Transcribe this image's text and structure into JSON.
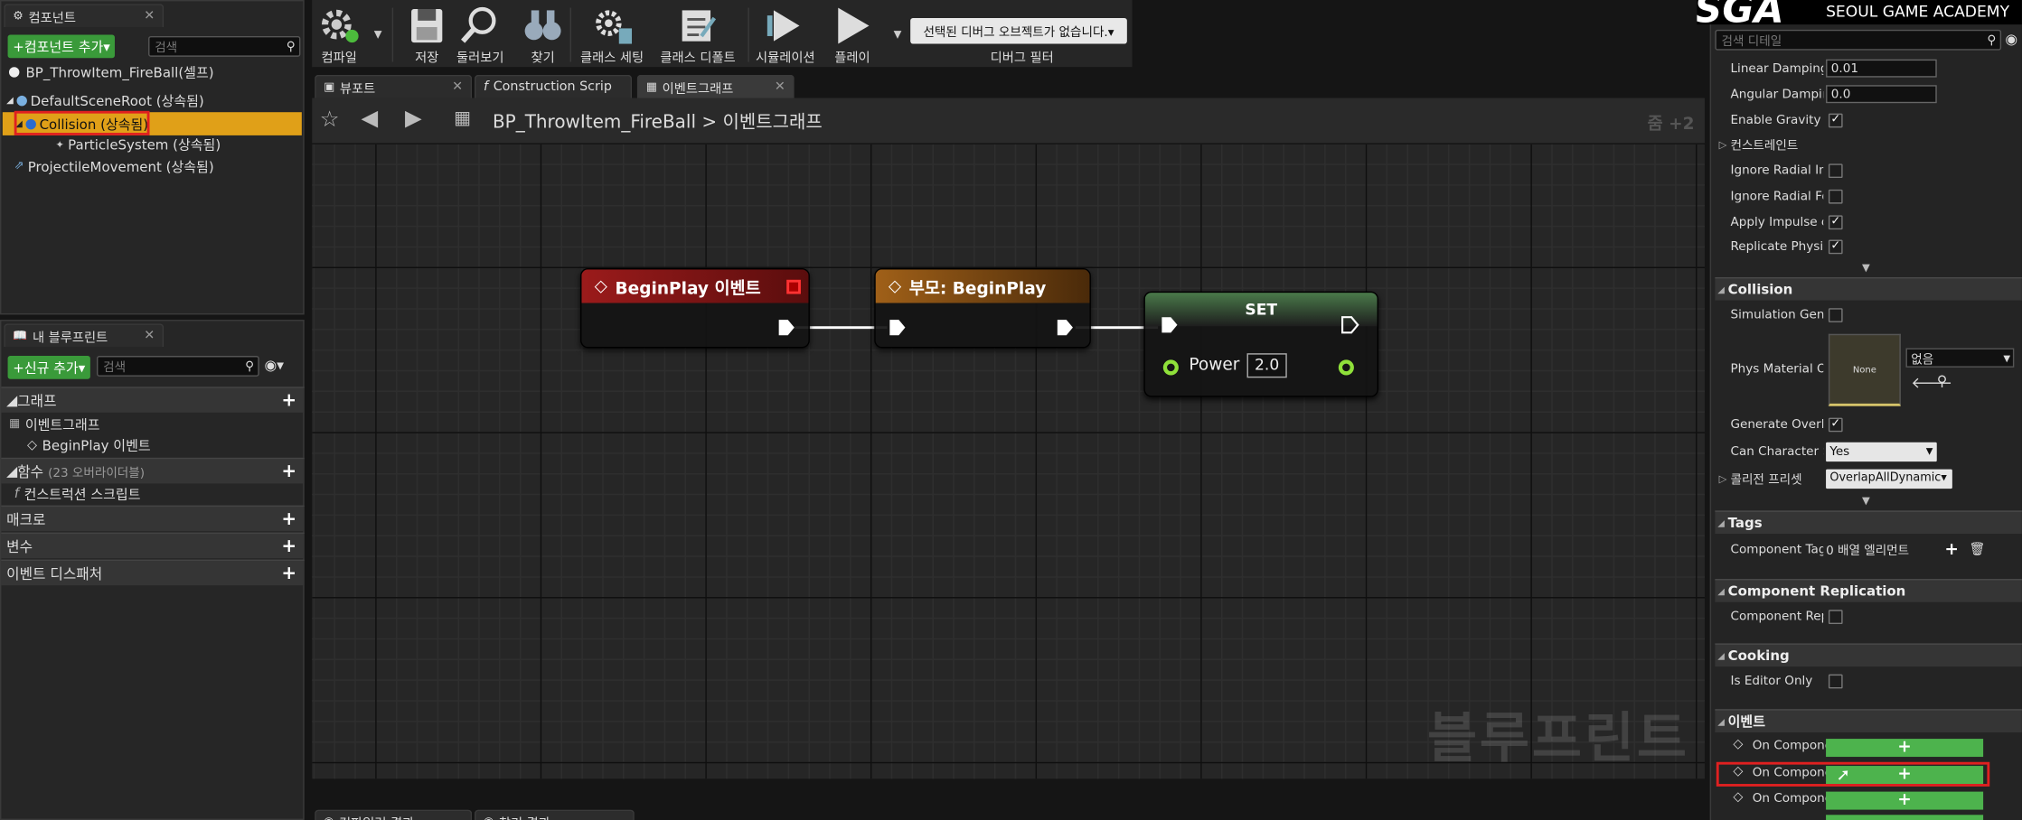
{
  "components_panel": {
    "tab": "컴포넌트",
    "add_button": "+컴포넌트 추가▾",
    "search_placeholder": "검색",
    "root_item": "BP_ThrowItem_FireBall(셀프)",
    "tree": [
      {
        "label": "DefaultSceneRoot (상속됨)"
      },
      {
        "label": "Collision (상속됨)"
      },
      {
        "label": "ParticleSystem (상속됨)"
      },
      {
        "label": "ProjectileMovement (상속됨)"
      }
    ]
  },
  "my_blueprint": {
    "tab": "내 블루프린트",
    "new_button": "+신규 추가▾",
    "search_placeholder": "검색",
    "graphs_label": "그래프",
    "event_graph": "이벤트그래프",
    "beginplay_event": "BeginPlay 이벤트",
    "functions_label": "함수",
    "functions_note": "(23 오버라이더블)",
    "construction_script": "컨스트럭션 스크립트",
    "macros_label": "매크로",
    "variables_label": "변수",
    "dispatchers_label": "이벤트 디스패처"
  },
  "toolbar": {
    "compile": "컴파일",
    "save": "저장",
    "browse": "둘러보기",
    "find": "찾기",
    "class_settings": "클래스 세팅",
    "class_defaults": "클래스 디폴트",
    "simulation": "시뮬레이션",
    "play": "플레이",
    "debug_select": "선택된 디버그 오브젝트가 없습니다.▾",
    "debug_filter": "디버그 필터"
  },
  "tabs": {
    "viewport": "뷰포트",
    "construction": "Construction Scrip",
    "event_graph": "이벤트그래프"
  },
  "graph": {
    "breadcrumb_bp": "BP_ThrowItem_FireBall",
    "breadcrumb_sep": ">",
    "breadcrumb_graph": "이벤트그래프",
    "zoom": "줌 +2",
    "watermark": "블루프린트",
    "nodes": {
      "beginplay": "BeginPlay 이벤트",
      "parent": "부모: BeginPlay",
      "set": "SET",
      "power_label": "Power",
      "power_value": "2.0"
    }
  },
  "bottom_tabs": {
    "compile_results": "컴파일러 결과",
    "find_results": "찾기 결과"
  },
  "details": {
    "search_placeholder": "검색 디테일",
    "brand": "SEOUL GAME ACADEMY",
    "physics": [
      {
        "label": "Linear Damping",
        "value": "0.01"
      },
      {
        "label": "Angular Damping",
        "value": "0.0"
      },
      {
        "label": "Enable Gravity",
        "checked": "✓"
      },
      {
        "label": "컨스트레인트"
      },
      {
        "label": "Ignore Radial Imp",
        "checked": ""
      },
      {
        "label": "Ignore Radial For",
        "checked": ""
      },
      {
        "label": "Apply Impulse on",
        "checked": "✓"
      },
      {
        "label": "Replicate Physic",
        "checked": "✓"
      }
    ],
    "collision_header": "Collision",
    "simulation_gen": "Simulation Gener",
    "phys_material": "Phys Material Ov",
    "phys_none": "None",
    "phys_dropdown": "없음",
    "generate_overlap": "Generate Overlap",
    "can_character": "Can Character St",
    "can_character_value": "Yes",
    "collision_preset": "콜리전 프리셋",
    "collision_preset_value": "OverlapAllDynamic▾",
    "tags_header": "Tags",
    "component_tags": "Component Tags",
    "component_tags_value": "0 배열 엘리먼트",
    "replication_header": "Component Replication",
    "component_repl": "Component Repli",
    "cooking_header": "Cooking",
    "is_editor_only": "Is Editor Only",
    "events_header": "이벤트",
    "event_items": [
      {
        "label": "On Compone"
      },
      {
        "label": "On Compone"
      },
      {
        "label": "On Compone"
      }
    ]
  },
  "colors": {
    "accent_orange": "#e8a317",
    "green": "#3a9a3a",
    "red_box": "#e02020"
  }
}
